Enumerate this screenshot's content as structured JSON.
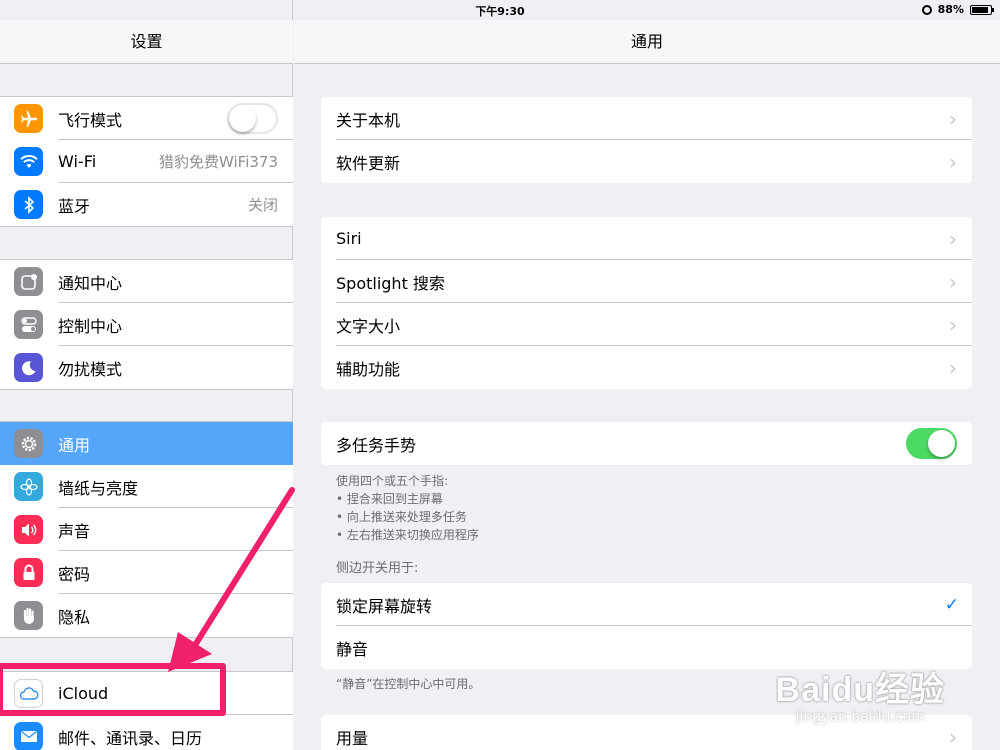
{
  "status": {
    "device": "iPad",
    "time": "下午9:30",
    "battery": "88%"
  },
  "sidebar": {
    "title": "设置",
    "groups": [
      [
        {
          "label": "飞行模式",
          "icon": "airplane-icon",
          "color": "#ff9500",
          "toggle": "off"
        },
        {
          "label": "Wi-Fi",
          "icon": "wifi-icon",
          "color": "#007aff",
          "value": "猎豹免费WiFi373"
        },
        {
          "label": "蓝牙",
          "icon": "bluetooth-icon",
          "color": "#007aff",
          "value": "关闭"
        }
      ],
      [
        {
          "label": "通知中心",
          "icon": "notification-icon",
          "color": "#8e8e93"
        },
        {
          "label": "控制中心",
          "icon": "control-center-icon",
          "color": "#8e8e93"
        },
        {
          "label": "勿扰模式",
          "icon": "moon-icon",
          "color": "#5856d6"
        }
      ],
      [
        {
          "label": "通用",
          "icon": "gear-icon",
          "color": "#8e8e93",
          "selected": true
        },
        {
          "label": "墙纸与亮度",
          "icon": "flower-icon",
          "color": "#34aadc"
        },
        {
          "label": "声音",
          "icon": "speaker-icon",
          "color": "#ff2d55"
        },
        {
          "label": "密码",
          "icon": "lock-icon",
          "color": "#ff2d55"
        },
        {
          "label": "隐私",
          "icon": "hand-icon",
          "color": "#8e8e93"
        }
      ],
      [
        {
          "label": "iCloud",
          "icon": "cloud-icon",
          "color": "#ffffff"
        },
        {
          "label": "邮件、通讯录、日历",
          "icon": "mail-icon",
          "color": "#1a8cff"
        }
      ]
    ]
  },
  "main": {
    "title": "通用",
    "group1": [
      "关于本机",
      "软件更新"
    ],
    "group2": [
      "Siri",
      "Spotlight 搜索",
      "文字大小",
      "辅助功能"
    ],
    "multitask": {
      "label": "多任务手势",
      "toggle": "on"
    },
    "multitask_note": [
      "使用四个或五个手指:",
      "• 捏合来回到主屏幕",
      "• 向上推送来处理多任务",
      "• 左右推送来切换应用程序"
    ],
    "side_switch_header": "侧边开关用于:",
    "side_switch": [
      {
        "label": "锁定屏幕旋转",
        "checked": true
      },
      {
        "label": "静音",
        "checked": false
      }
    ],
    "side_switch_note": "“静音”在控制中心中可用。",
    "usage": "用量"
  },
  "watermark": {
    "logo": "Baidu经验",
    "url": "jingyan.baidu.com"
  },
  "colors": {
    "accent": "#007aff",
    "selected_row": "#55a6f8",
    "toggle_on": "#4cd964",
    "annotation": "#f0206a"
  }
}
